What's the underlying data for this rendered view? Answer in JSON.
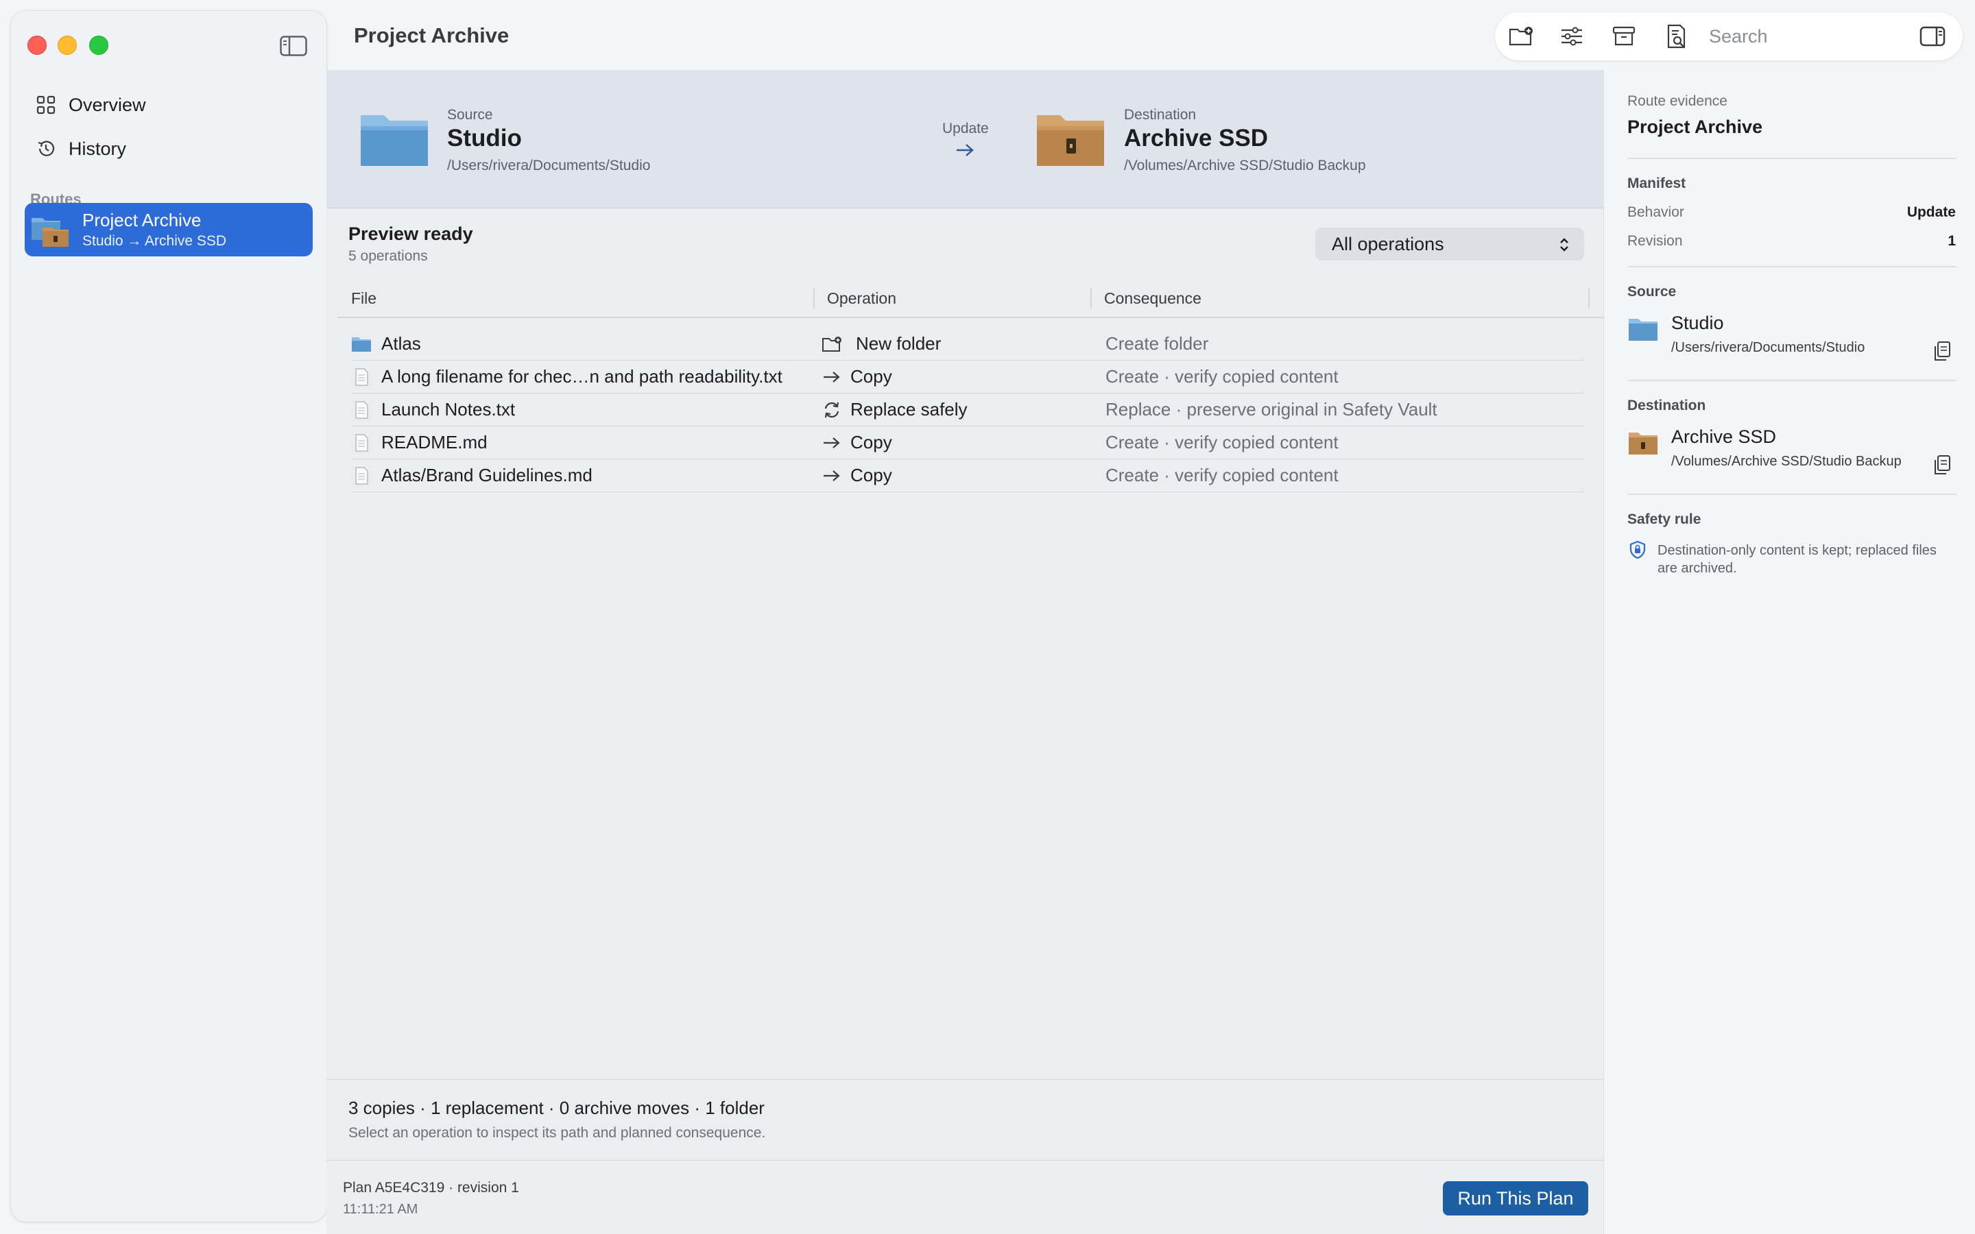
{
  "window": {
    "title": "Project Archive"
  },
  "sidebar": {
    "nav": [
      {
        "label": "Overview",
        "icon": "grid-icon"
      },
      {
        "label": "History",
        "icon": "clock-history-icon"
      }
    ],
    "section_label": "Routes",
    "routes": [
      {
        "title": "Project Archive",
        "subtitle": "Studio → Archive SSD",
        "selected": true
      }
    ]
  },
  "toolbar": {
    "icons": [
      "new-folder-icon",
      "sliders-icon",
      "archive-box-icon",
      "inspect-document-icon",
      "inspector-toggle-icon"
    ],
    "search_placeholder": "Search"
  },
  "route_header": {
    "source": {
      "label": "Source",
      "name": "Studio",
      "path": "/Users/rivera/Documents/Studio"
    },
    "behavior": "Update",
    "destination": {
      "label": "Destination",
      "name": "Archive SSD",
      "path": "/Volumes/Archive SSD/Studio Backup"
    }
  },
  "preview": {
    "title": "Preview ready",
    "subtitle": "5 operations",
    "filter": "All operations",
    "columns": [
      "File",
      "Operation",
      "Consequence"
    ],
    "rows": [
      {
        "file": "Atlas",
        "file_icon": "folder-icon",
        "op_icon": "new-folder-icon",
        "operation": "New folder",
        "consequence": "Create folder"
      },
      {
        "file": "A long filename for chec…n and path readability.txt",
        "file_icon": "document-icon",
        "op_icon": "arrow-right-icon",
        "operation": "Copy",
        "consequence": "Create · verify copied content"
      },
      {
        "file": "Launch Notes.txt",
        "file_icon": "document-icon",
        "op_icon": "sync-icon",
        "operation": "Replace safely",
        "consequence": "Replace · preserve original in Safety Vault"
      },
      {
        "file": "README.md",
        "file_icon": "document-icon",
        "op_icon": "arrow-right-icon",
        "operation": "Copy",
        "consequence": "Create · verify copied content"
      },
      {
        "file": "Atlas/Brand Guidelines.md",
        "file_icon": "document-icon",
        "op_icon": "arrow-right-icon",
        "operation": "Copy",
        "consequence": "Create · verify copied content"
      }
    ]
  },
  "summary": {
    "main": "3 copies · 1 replacement · 0 archive moves · 1 folder",
    "hint": "Select an operation to inspect its path and planned consequence."
  },
  "footer": {
    "plan": "Plan A5E4C319 · revision 1",
    "time": "11:11:21 AM",
    "run_button": "Run This Plan"
  },
  "inspector": {
    "label": "Route evidence",
    "title": "Project Archive",
    "manifest": {
      "heading": "Manifest",
      "behavior_label": "Behavior",
      "behavior_value": "Update",
      "revision_label": "Revision",
      "revision_value": "1"
    },
    "source": {
      "heading": "Source",
      "name": "Studio",
      "path": "/Users/rivera/Documents/Studio"
    },
    "destination": {
      "heading": "Destination",
      "name": "Archive SSD",
      "path": "/Volumes/Archive SSD/Studio Backup"
    },
    "safety": {
      "heading": "Safety rule",
      "text": "Destination-only content is kept; replaced files are archived."
    }
  },
  "colors": {
    "accent": "#2c6bd8",
    "run_button": "#1d5fa3",
    "header_band": "#dfe4ec",
    "folder_blue": "#5b97cf",
    "folder_brown": "#b8844c"
  }
}
